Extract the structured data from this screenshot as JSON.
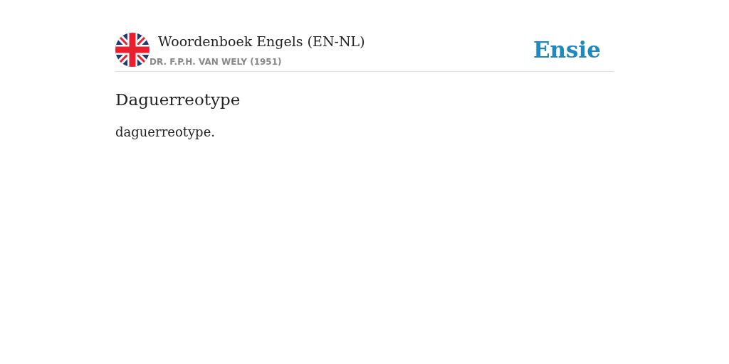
{
  "header": {
    "title": "Woordenboek Engels (EN-NL)",
    "author": "DR. F.P.H. VAN WELY (1951)",
    "logo": "Ensie"
  },
  "entry": {
    "term": "Daguerreotype",
    "definition": "daguerreotype."
  }
}
